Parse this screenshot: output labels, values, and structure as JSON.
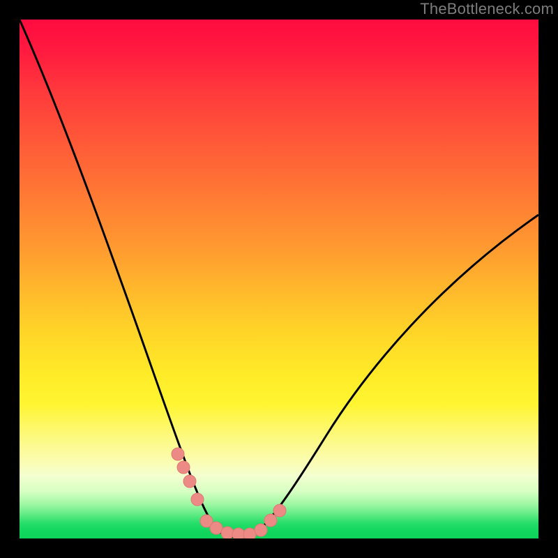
{
  "watermark": "TheBottleneck.com",
  "chart_data": {
    "type": "line",
    "title": "",
    "xlabel": "",
    "ylabel": "",
    "xlim": [
      0,
      100
    ],
    "ylim": [
      0,
      100
    ],
    "background_gradient": {
      "direction": "vertical",
      "top": "#ff0b3f",
      "bottom": "#0fd45b",
      "meaning_top": "bad",
      "meaning_bottom": "good"
    },
    "series": [
      {
        "name": "bottleneck-curve",
        "color": "#000000",
        "x": [
          0,
          4,
          8,
          12,
          16,
          20,
          24,
          28,
          31,
          33,
          35,
          37,
          40,
          43,
          46,
          52,
          60,
          70,
          82,
          92,
          100
        ],
        "values": [
          100,
          90,
          78,
          66,
          54,
          42,
          30,
          18,
          10,
          6,
          3,
          1,
          0,
          0,
          1,
          4,
          12,
          24,
          40,
          52,
          60
        ]
      }
    ],
    "markers": [
      {
        "name": "left-pink-marker",
        "color": "#ec8a86",
        "x": [
          27.6,
          29.0,
          30.4,
          32.2
        ],
        "values": [
          18.5,
          14.0,
          10.2,
          5.0
        ]
      },
      {
        "name": "bottom-pink-marker",
        "color": "#ec8a86",
        "x": [
          34.0,
          36.0,
          38.5,
          41.0,
          43.5,
          46.0
        ],
        "values": [
          2.6,
          1.6,
          0.8,
          0.6,
          0.6,
          1.2
        ]
      },
      {
        "name": "right-pink-marker",
        "color": "#ec8a86",
        "x": [
          47.8,
          49.6
        ],
        "values": [
          2.6,
          4.4
        ]
      }
    ]
  }
}
